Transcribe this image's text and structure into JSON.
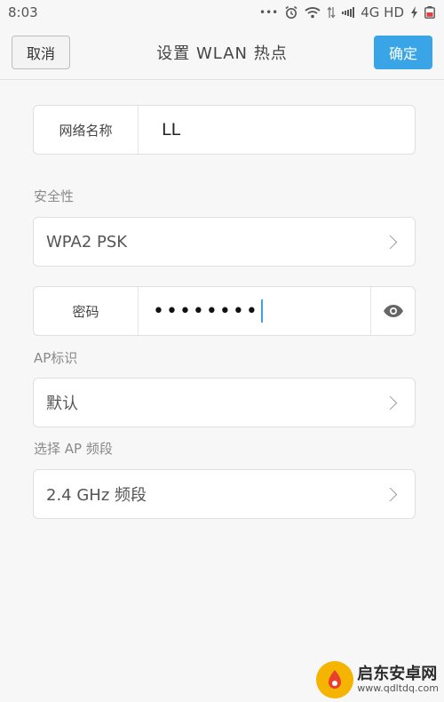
{
  "status_bar": {
    "time": "8:03",
    "dots": "•••",
    "network": "4G HD"
  },
  "header": {
    "cancel_label": "取消",
    "title": "设置 WLAN 热点",
    "confirm_label": "确定",
    "accent_color": "#3aa5e6"
  },
  "form": {
    "network_name": {
      "label": "网络名称",
      "value": "LL"
    },
    "security": {
      "section_label": "安全性",
      "value": "WPA2 PSK"
    },
    "password": {
      "label": "密码",
      "masked_value": "••••••••"
    },
    "ap_id": {
      "section_label": "AP标识",
      "value": "默认"
    },
    "band": {
      "section_label": "选择 AP 频段",
      "value": "2.4 GHz 频段"
    }
  },
  "watermark": {
    "title": "启东安卓网",
    "url": "www.qdltdq.com"
  },
  "icons": [
    "alarm-icon",
    "wifi-icon",
    "data-arrows-icon",
    "signal-icon",
    "charging-icon",
    "battery-icon",
    "eye-icon",
    "chevron-right-icon"
  ]
}
